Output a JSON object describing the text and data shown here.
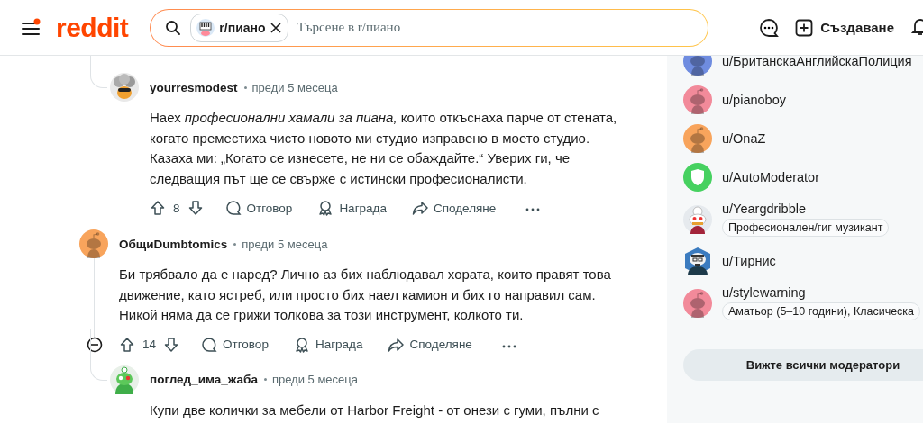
{
  "header": {
    "logo": "reddit",
    "search": {
      "chip": "r/пиано",
      "placeholder": "Търсене в r/пиано"
    },
    "create_label": "Създаване"
  },
  "comments": [
    {
      "kind": "reply",
      "author": "yourresmodest",
      "avatar": {
        "kind": "fluffy"
      },
      "time": "преди 5 месеца",
      "body": "Наех *професионални хамали за пиана,* които откъснаха парче от стената, когато преместиха чисто новото ми студио изправено в моето студио. Казаха ми: „Когато се изнесете, не ни се обаждайте.“ Уверих ги, че следващия път ще се свърже с истински професионалисти.",
      "votes": "8",
      "collapsible": false,
      "actions": [
        {
          "kind": "reply",
          "label": "Отговор"
        },
        {
          "kind": "award",
          "label": "Награда"
        },
        {
          "kind": "share",
          "label": "Споделяне"
        }
      ]
    },
    {
      "kind": "top",
      "author": "ОбщиDumbtomics",
      "avatar": {
        "kind": "snoo",
        "color": "#f8a45c"
      },
      "time": "преди 5 месеца",
      "body": "Би трябвало да е наред? Лично аз бих наблюдавал хората, които правят това движение, като ястреб, или просто бих наел камион и бих го направил сам. Никой няма да се грижи толкова за този инструмент, колкото ти.",
      "votes": "14",
      "collapsible": true,
      "actions": [
        {
          "kind": "reply",
          "label": "Отговор"
        },
        {
          "kind": "award",
          "label": "Награда"
        },
        {
          "kind": "share",
          "label": "Споделяне"
        }
      ],
      "children": [
        {
          "kind": "reply",
          "author": "поглед_има_жаба",
          "avatar": {
            "kind": "frog"
          },
          "time": "преди 5 месеца",
          "body": "Купи две колички за мебели от Harbor Freight - от онези с гуми, пълни с"
        }
      ]
    }
  ],
  "moderators": {
    "items": [
      {
        "name": "u/БританскаАнглийскаПолиция",
        "avatar": {
          "kind": "snoo",
          "color": "#6f8ce0"
        }
      },
      {
        "name": "u/pianoboy",
        "avatar": {
          "kind": "snoo",
          "color": "#f28a9a"
        }
      },
      {
        "name": "u/OnaZ",
        "avatar": {
          "kind": "snoo",
          "color": "#f8a45c"
        }
      },
      {
        "name": "u/AutoModerator",
        "avatar": {
          "kind": "shield",
          "color": "#46d160"
        }
      },
      {
        "name": "u/Yeargdribble",
        "avatar": {
          "kind": "chef"
        },
        "flair": "Професионален/гиг музикант"
      },
      {
        "name": "u/Тирнис",
        "avatar": {
          "kind": "hex"
        }
      },
      {
        "name": "u/stylewarning",
        "avatar": {
          "kind": "snoo",
          "color": "#f28a9a"
        },
        "flair": "Аматьор (5–10 години), Класическа"
      }
    ],
    "button": "Вижте всички модератори"
  }
}
